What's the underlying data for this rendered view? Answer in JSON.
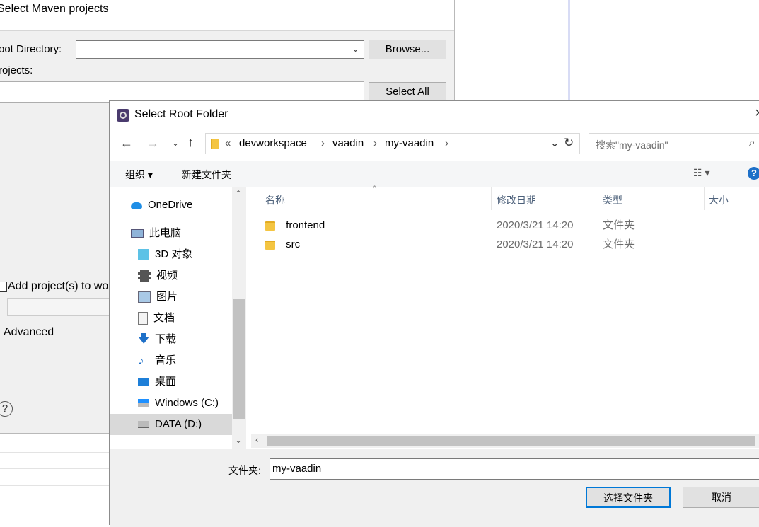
{
  "maven": {
    "title": "Select Maven projects",
    "root_dir_label": "oot Directory:",
    "browse_label": "Browse...",
    "projects_label": "rojects:",
    "select_all_label": "Select All",
    "add_projects_label": "Add project(s) to wo",
    "advanced_label": "Advanced",
    "help_glyph": "?"
  },
  "dialog": {
    "title": "Select Root Folder",
    "close_glyph": "×",
    "breadcrumb": [
      "«",
      "devworkspace",
      "vaadin",
      "my-vaadin"
    ],
    "search_placeholder": "搜索\"my-vaadin\"",
    "toolbar": {
      "organize": "组织 ▾",
      "new_folder": "新建文件夹",
      "view_glyph": "☷ ▾",
      "help_glyph": "?"
    },
    "nav": [
      {
        "label": "OneDrive",
        "icon": "cloud-icon"
      },
      {
        "label": "此电脑",
        "icon": "computer-icon"
      },
      {
        "label": "3D 对象",
        "icon": "cube-icon"
      },
      {
        "label": "视频",
        "icon": "video-icon"
      },
      {
        "label": "图片",
        "icon": "picture-icon"
      },
      {
        "label": "文档",
        "icon": "document-icon"
      },
      {
        "label": "下载",
        "icon": "download-icon"
      },
      {
        "label": "音乐",
        "icon": "music-icon"
      },
      {
        "label": "桌面",
        "icon": "desktop-icon"
      },
      {
        "label": "Windows (C:)",
        "icon": "drive-icon"
      },
      {
        "label": "DATA (D:)",
        "icon": "drive-icon"
      }
    ],
    "columns": {
      "name": "名称",
      "date": "修改日期",
      "type": "类型",
      "size": "大小"
    },
    "files": [
      {
        "name": "frontend",
        "date": "2020/3/21 14:20",
        "type": "文件夹"
      },
      {
        "name": "src",
        "date": "2020/3/21 14:20",
        "type": "文件夹"
      }
    ],
    "folder_label": "文件夹:",
    "folder_value": "my-vaadin",
    "ok_label": "选择文件夹",
    "cancel_label": "取消"
  }
}
